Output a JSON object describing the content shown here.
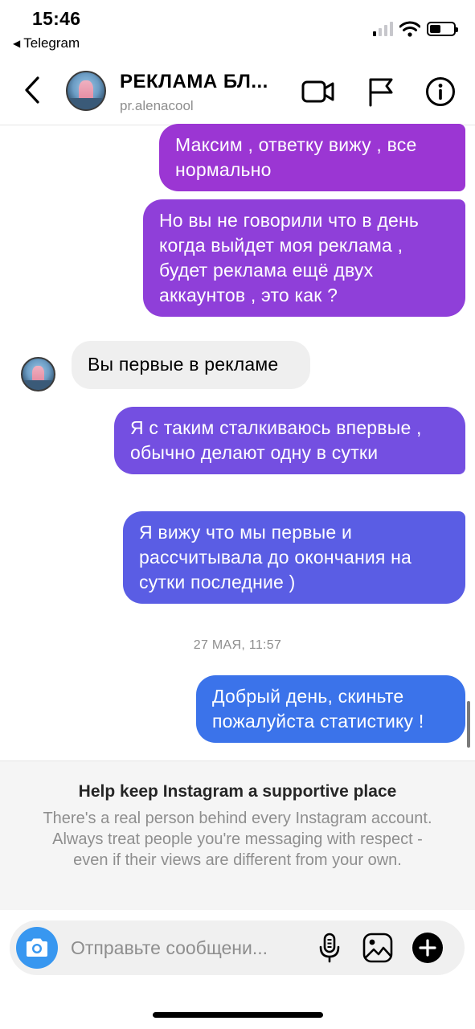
{
  "status_bar": {
    "time": "15:46",
    "back_app": "Telegram",
    "signal_bars_active": 1,
    "battery_percent": 45
  },
  "header": {
    "title": "РЕКЛАМА БЛ...",
    "username": "pr.alenacool",
    "icons": [
      "back-chevron-icon",
      "video-call-icon",
      "flag-icon",
      "info-icon"
    ]
  },
  "messages": [
    {
      "direction": "out",
      "text": "Максим , ответку вижу , все нормально",
      "color": "#9b36d3"
    },
    {
      "direction": "out",
      "text": "Но вы не говорили что в день когда выйдет моя реклама , будет реклама ещё двух аккаунтов , это как ?",
      "color": "#8f3fd9"
    },
    {
      "direction": "in",
      "text": "Вы первые в рекламе",
      "color": "#efefef"
    },
    {
      "direction": "out",
      "text": "Я с таким сталкиваюсь впервые , обычно делают одну в сутки",
      "color": "#744fe1"
    },
    {
      "direction": "out",
      "text": "Я вижу что мы первые  и рассчитывала до окончания  на сутки последние )",
      "color": "#5a5de4"
    },
    {
      "direction": "out",
      "text": "Добрый день, скиньте пожалуйста статистику !",
      "color": "#3b73ea"
    }
  ],
  "timestamp": "27 МАЯ, 11:57",
  "notice": {
    "title": "Help keep Instagram a supportive place",
    "body": "There's a real person behind every Instagram account. Always treat people you're messaging with respect - even if their views are different from your own."
  },
  "composer": {
    "placeholder": "Отправьте сообщени...",
    "value": "",
    "camera_color": "#3897f0",
    "icons": [
      "camera-icon",
      "microphone-icon",
      "gallery-icon",
      "add-icon"
    ]
  }
}
